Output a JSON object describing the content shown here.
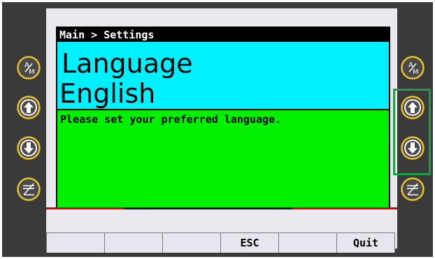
{
  "screen": {
    "breadcrumb": "Main > Settings",
    "title": "Language",
    "value": "English",
    "message": "Please set your preferred language."
  },
  "softkeys": [
    "",
    "",
    "",
    "ESC",
    "",
    "Quit"
  ],
  "hardware_buttons": {
    "left": [
      "auto-manual-icon",
      "arrow-up-icon",
      "arrow-down-icon",
      "enter-icon"
    ],
    "right": [
      "auto-manual-icon",
      "arrow-up-icon",
      "arrow-down-icon",
      "enter-icon"
    ]
  },
  "colors": {
    "title_bg": "#00f0ff",
    "message_bg": "#00f000",
    "button_ring": "#e8c22a",
    "highlight": "#1d9f45",
    "red_line": "#e60000"
  }
}
